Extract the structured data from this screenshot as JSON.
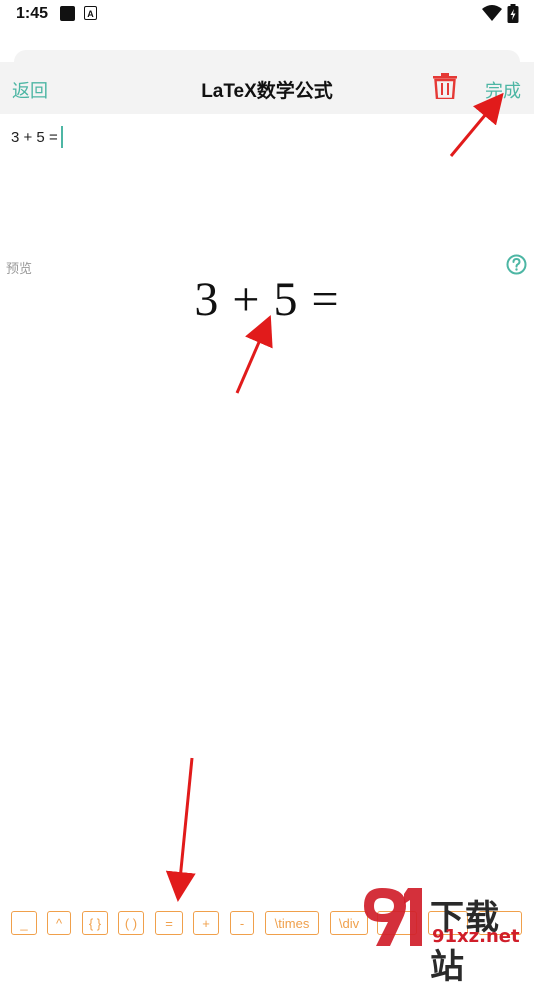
{
  "status_bar": {
    "time": "1:45",
    "a_label": "A"
  },
  "header": {
    "back_label": "返回",
    "title": "LaTeX数学公式",
    "done_label": "完成"
  },
  "editor": {
    "value": "3 + 5 ="
  },
  "preview": {
    "label": "预览",
    "formula": "3 + 5 ="
  },
  "toolbar": {
    "keys": [
      "_",
      "^",
      "{ }",
      "( )",
      "=",
      "+",
      "-",
      "\\times",
      "\\div"
    ]
  },
  "watermark": {
    "main": "下载站",
    "sub": "91xz.net"
  },
  "colors": {
    "accent": "#4db6a4",
    "delete": "#e53935",
    "key_border": "#f0a04b",
    "annotation_arrow": "#e11b1b"
  }
}
